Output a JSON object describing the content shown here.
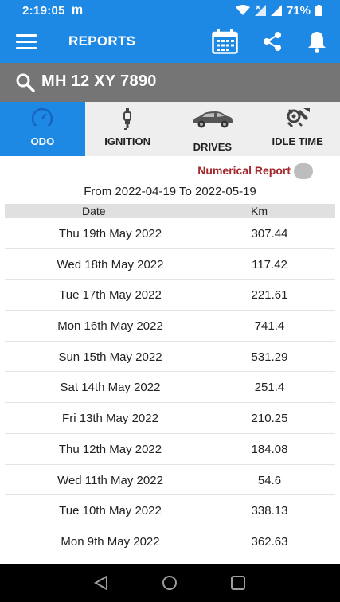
{
  "status": {
    "time": "2:19:05",
    "notification_glyph": "m",
    "battery": "71%"
  },
  "header": {
    "title": "REPORTS",
    "icons": [
      "menu-icon",
      "calendar-icon",
      "share-icon",
      "bell-icon"
    ]
  },
  "search": {
    "value": "MH 12 XY 7890"
  },
  "tabs": [
    {
      "label": "ODO",
      "icon": "speedometer-icon",
      "active": true
    },
    {
      "label": "IGNITION",
      "icon": "spark-plug-icon",
      "active": false
    },
    {
      "label": "DRIVES",
      "icon": "car-icon",
      "active": false
    },
    {
      "label": "IDLE TIME",
      "icon": "tools-icon",
      "active": false
    }
  ],
  "report": {
    "toggle_label": "Numerical Report",
    "range_text": "From 2022-04-19 To 2022-05-19"
  },
  "table": {
    "headers": {
      "date": "Date",
      "km": "Km"
    },
    "rows": [
      {
        "date": "Thu 19th May 2022",
        "km": "307.44"
      },
      {
        "date": "Wed 18th May 2022",
        "km": "117.42"
      },
      {
        "date": "Tue 17th May 2022",
        "km": "221.61"
      },
      {
        "date": "Mon 16th May 2022",
        "km": "741.4"
      },
      {
        "date": "Sun 15th May 2022",
        "km": "531.29"
      },
      {
        "date": "Sat 14th May 2022",
        "km": "251.4"
      },
      {
        "date": "Fri 13th May 2022",
        "km": "210.25"
      },
      {
        "date": "Thu 12th May 2022",
        "km": "184.08"
      },
      {
        "date": "Wed 11th May 2022",
        "km": "54.6"
      },
      {
        "date": "Tue 10th May 2022",
        "km": "338.13"
      },
      {
        "date": "Mon 9th May 2022",
        "km": "362.63"
      }
    ]
  },
  "colors": {
    "primary": "#1e88e5",
    "search_bg": "#757575",
    "report_label": "#a4282b"
  }
}
